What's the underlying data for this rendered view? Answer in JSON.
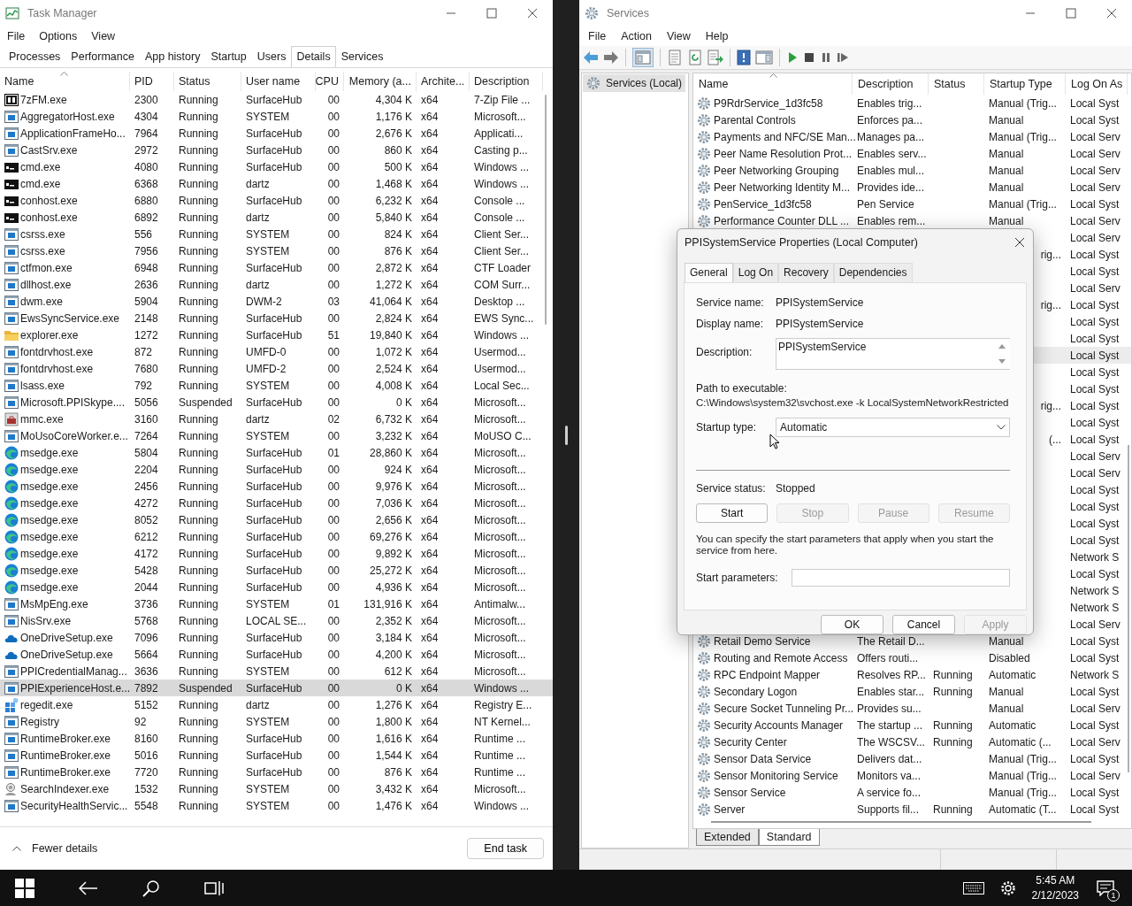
{
  "task_manager": {
    "window_title": "Task Manager",
    "menu": [
      "File",
      "Options",
      "View"
    ],
    "tabs": [
      {
        "label": "Processes",
        "selected": false
      },
      {
        "label": "Performance",
        "selected": false
      },
      {
        "label": "App history",
        "selected": false
      },
      {
        "label": "Startup",
        "selected": false
      },
      {
        "label": "Users",
        "selected": false
      },
      {
        "label": "Details",
        "selected": true
      },
      {
        "label": "Services",
        "selected": false
      }
    ],
    "columns": [
      "Name",
      "PID",
      "Status",
      "User name",
      "CPU",
      "Memory (a...",
      "Archite...",
      "Description"
    ],
    "rows": [
      {
        "kind": "zip",
        "name": "7zFM.exe",
        "pid": "2300",
        "status": "Running",
        "user": "SurfaceHub",
        "cpu": "00",
        "memory": "4,304 K",
        "arch": "x64",
        "description": "7-Zip File ...",
        "selected": false
      },
      {
        "kind": "app",
        "name": "AggregatorHost.exe",
        "pid": "4304",
        "status": "Running",
        "user": "SYSTEM",
        "cpu": "00",
        "memory": "1,176 K",
        "arch": "x64",
        "description": "Microsoft...",
        "selected": false
      },
      {
        "kind": "app",
        "name": "ApplicationFrameHo...",
        "pid": "7964",
        "status": "Running",
        "user": "SurfaceHub",
        "cpu": "00",
        "memory": "2,676 K",
        "arch": "x64",
        "description": "Applicati...",
        "selected": false
      },
      {
        "kind": "app",
        "name": "CastSrv.exe",
        "pid": "2972",
        "status": "Running",
        "user": "SurfaceHub",
        "cpu": "00",
        "memory": "860 K",
        "arch": "x64",
        "description": "Casting p...",
        "selected": false
      },
      {
        "kind": "console",
        "name": "cmd.exe",
        "pid": "4080",
        "status": "Running",
        "user": "SurfaceHub",
        "cpu": "00",
        "memory": "500 K",
        "arch": "x64",
        "description": "Windows ...",
        "selected": false
      },
      {
        "kind": "console",
        "name": "cmd.exe",
        "pid": "6368",
        "status": "Running",
        "user": "dartz",
        "cpu": "00",
        "memory": "1,468 K",
        "arch": "x64",
        "description": "Windows ...",
        "selected": false
      },
      {
        "kind": "console",
        "name": "conhost.exe",
        "pid": "6880",
        "status": "Running",
        "user": "SurfaceHub",
        "cpu": "00",
        "memory": "6,232 K",
        "arch": "x64",
        "description": "Console ...",
        "selected": false
      },
      {
        "kind": "console",
        "name": "conhost.exe",
        "pid": "6892",
        "status": "Running",
        "user": "dartz",
        "cpu": "00",
        "memory": "5,840 K",
        "arch": "x64",
        "description": "Console ...",
        "selected": false
      },
      {
        "kind": "app",
        "name": "csrss.exe",
        "pid": "556",
        "status": "Running",
        "user": "SYSTEM",
        "cpu": "00",
        "memory": "824 K",
        "arch": "x64",
        "description": "Client Ser...",
        "selected": false
      },
      {
        "kind": "app",
        "name": "csrss.exe",
        "pid": "7956",
        "status": "Running",
        "user": "SYSTEM",
        "cpu": "00",
        "memory": "876 K",
        "arch": "x64",
        "description": "Client Ser...",
        "selected": false
      },
      {
        "kind": "app",
        "name": "ctfmon.exe",
        "pid": "6948",
        "status": "Running",
        "user": "SurfaceHub",
        "cpu": "00",
        "memory": "2,872 K",
        "arch": "x64",
        "description": "CTF Loader",
        "selected": false
      },
      {
        "kind": "app",
        "name": "dllhost.exe",
        "pid": "2636",
        "status": "Running",
        "user": "dartz",
        "cpu": "00",
        "memory": "1,272 K",
        "arch": "x64",
        "description": "COM Surr...",
        "selected": false
      },
      {
        "kind": "app",
        "name": "dwm.exe",
        "pid": "5904",
        "status": "Running",
        "user": "DWM-2",
        "cpu": "03",
        "memory": "41,064 K",
        "arch": "x64",
        "description": "Desktop ...",
        "selected": false
      },
      {
        "kind": "app",
        "name": "EwsSyncService.exe",
        "pid": "2148",
        "status": "Running",
        "user": "SurfaceHub",
        "cpu": "00",
        "memory": "2,824 K",
        "arch": "x64",
        "description": "EWS Sync...",
        "selected": false
      },
      {
        "kind": "folder",
        "name": "explorer.exe",
        "pid": "1272",
        "status": "Running",
        "user": "SurfaceHub",
        "cpu": "51",
        "memory": "19,840 K",
        "arch": "x64",
        "description": "Windows ...",
        "selected": false
      },
      {
        "kind": "app",
        "name": "fontdrvhost.exe",
        "pid": "872",
        "status": "Running",
        "user": "UMFD-0",
        "cpu": "00",
        "memory": "1,072 K",
        "arch": "x64",
        "description": "Usermod...",
        "selected": false
      },
      {
        "kind": "app",
        "name": "fontdrvhost.exe",
        "pid": "7680",
        "status": "Running",
        "user": "UMFD-2",
        "cpu": "00",
        "memory": "2,524 K",
        "arch": "x64",
        "description": "Usermod...",
        "selected": false
      },
      {
        "kind": "app",
        "name": "lsass.exe",
        "pid": "792",
        "status": "Running",
        "user": "SYSTEM",
        "cpu": "00",
        "memory": "4,008 K",
        "arch": "x64",
        "description": "Local Sec...",
        "selected": false
      },
      {
        "kind": "app",
        "name": "Microsoft.PPISkype....",
        "pid": "5056",
        "status": "Suspended",
        "user": "SurfaceHub",
        "cpu": "00",
        "memory": "0 K",
        "arch": "x64",
        "description": "Microsoft...",
        "selected": false
      },
      {
        "kind": "toolbox",
        "name": "mmc.exe",
        "pid": "3160",
        "status": "Running",
        "user": "dartz",
        "cpu": "02",
        "memory": "6,732 K",
        "arch": "x64",
        "description": "Microsoft...",
        "selected": false
      },
      {
        "kind": "app",
        "name": "MoUsoCoreWorker.e...",
        "pid": "7264",
        "status": "Running",
        "user": "SYSTEM",
        "cpu": "00",
        "memory": "3,232 K",
        "arch": "x64",
        "description": "MoUSO C...",
        "selected": false
      },
      {
        "kind": "swirl",
        "name": "msedge.exe",
        "pid": "5804",
        "status": "Running",
        "user": "SurfaceHub",
        "cpu": "01",
        "memory": "28,860 K",
        "arch": "x64",
        "description": "Microsoft...",
        "selected": false
      },
      {
        "kind": "swirl",
        "name": "msedge.exe",
        "pid": "2204",
        "status": "Running",
        "user": "SurfaceHub",
        "cpu": "00",
        "memory": "924 K",
        "arch": "x64",
        "description": "Microsoft...",
        "selected": false
      },
      {
        "kind": "swirl",
        "name": "msedge.exe",
        "pid": "2456",
        "status": "Running",
        "user": "SurfaceHub",
        "cpu": "00",
        "memory": "9,976 K",
        "arch": "x64",
        "description": "Microsoft...",
        "selected": false
      },
      {
        "kind": "swirl",
        "name": "msedge.exe",
        "pid": "4272",
        "status": "Running",
        "user": "SurfaceHub",
        "cpu": "00",
        "memory": "7,036 K",
        "arch": "x64",
        "description": "Microsoft...",
        "selected": false
      },
      {
        "kind": "swirl",
        "name": "msedge.exe",
        "pid": "8052",
        "status": "Running",
        "user": "SurfaceHub",
        "cpu": "00",
        "memory": "2,656 K",
        "arch": "x64",
        "description": "Microsoft...",
        "selected": false
      },
      {
        "kind": "swirl",
        "name": "msedge.exe",
        "pid": "6212",
        "status": "Running",
        "user": "SurfaceHub",
        "cpu": "00",
        "memory": "69,276 K",
        "arch": "x64",
        "description": "Microsoft...",
        "selected": false
      },
      {
        "kind": "swirl",
        "name": "msedge.exe",
        "pid": "4172",
        "status": "Running",
        "user": "SurfaceHub",
        "cpu": "00",
        "memory": "9,892 K",
        "arch": "x64",
        "description": "Microsoft...",
        "selected": false
      },
      {
        "kind": "swirl",
        "name": "msedge.exe",
        "pid": "5428",
        "status": "Running",
        "user": "SurfaceHub",
        "cpu": "00",
        "memory": "25,272 K",
        "arch": "x64",
        "description": "Microsoft...",
        "selected": false
      },
      {
        "kind": "swirl",
        "name": "msedge.exe",
        "pid": "2044",
        "status": "Running",
        "user": "SurfaceHub",
        "cpu": "00",
        "memory": "4,936 K",
        "arch": "x64",
        "description": "Microsoft...",
        "selected": false
      },
      {
        "kind": "app",
        "name": "MsMpEng.exe",
        "pid": "3736",
        "status": "Running",
        "user": "SYSTEM",
        "cpu": "01",
        "memory": "131,916 K",
        "arch": "x64",
        "description": "Antimalw...",
        "selected": false
      },
      {
        "kind": "app",
        "name": "NisSrv.exe",
        "pid": "5768",
        "status": "Running",
        "user": "LOCAL SE...",
        "cpu": "00",
        "memory": "2,352 K",
        "arch": "x64",
        "description": "Microsoft...",
        "selected": false
      },
      {
        "kind": "cloud",
        "name": "OneDriveSetup.exe",
        "pid": "7096",
        "status": "Running",
        "user": "SurfaceHub",
        "cpu": "00",
        "memory": "3,184 K",
        "arch": "x64",
        "description": "Microsoft...",
        "selected": false
      },
      {
        "kind": "cloud",
        "name": "OneDriveSetup.exe",
        "pid": "5664",
        "status": "Running",
        "user": "SurfaceHub",
        "cpu": "00",
        "memory": "4,200 K",
        "arch": "x64",
        "description": "Microsoft...",
        "selected": false
      },
      {
        "kind": "app",
        "name": "PPICredentialManag...",
        "pid": "3636",
        "status": "Running",
        "user": "SYSTEM",
        "cpu": "00",
        "memory": "612 K",
        "arch": "x64",
        "description": "Microsoft...",
        "selected": false
      },
      {
        "kind": "app",
        "name": "PPIExperienceHost.e...",
        "pid": "7892",
        "status": "Suspended",
        "user": "SurfaceHub",
        "cpu": "00",
        "memory": "0 K",
        "arch": "x64",
        "description": "Windows ...",
        "selected": true
      },
      {
        "kind": "cubes",
        "name": "regedit.exe",
        "pid": "5152",
        "status": "Running",
        "user": "dartz",
        "cpu": "00",
        "memory": "1,276 K",
        "arch": "x64",
        "description": "Registry E...",
        "selected": false
      },
      {
        "kind": "app",
        "name": "Registry",
        "pid": "92",
        "status": "Running",
        "user": "SYSTEM",
        "cpu": "00",
        "memory": "1,800 K",
        "arch": "x64",
        "description": "NT Kernel...",
        "selected": false
      },
      {
        "kind": "app",
        "name": "RuntimeBroker.exe",
        "pid": "8160",
        "status": "Running",
        "user": "SurfaceHub",
        "cpu": "00",
        "memory": "1,616 K",
        "arch": "x64",
        "description": "Runtime ...",
        "selected": false
      },
      {
        "kind": "app",
        "name": "RuntimeBroker.exe",
        "pid": "5016",
        "status": "Running",
        "user": "SurfaceHub",
        "cpu": "00",
        "memory": "1,544 K",
        "arch": "x64",
        "description": "Runtime ...",
        "selected": false
      },
      {
        "kind": "app",
        "name": "RuntimeBroker.exe",
        "pid": "7720",
        "status": "Running",
        "user": "SurfaceHub",
        "cpu": "00",
        "memory": "876 K",
        "arch": "x64",
        "description": "Runtime ...",
        "selected": false
      },
      {
        "kind": "magnifier",
        "name": "SearchIndexer.exe",
        "pid": "1532",
        "status": "Running",
        "user": "SYSTEM",
        "cpu": "00",
        "memory": "3,432 K",
        "arch": "x64",
        "description": "Microsoft...",
        "selected": false
      },
      {
        "kind": "app",
        "name": "SecurityHealthServic...",
        "pid": "5548",
        "status": "Running",
        "user": "SYSTEM",
        "cpu": "00",
        "memory": "1,476 K",
        "arch": "x64",
        "description": "Windows ...",
        "selected": false
      }
    ],
    "footer": {
      "toggle": "Fewer details",
      "end_task": "End task"
    }
  },
  "services": {
    "window_title": "Services",
    "menu": [
      "File",
      "Action",
      "View",
      "Help"
    ],
    "tree": [
      {
        "label": "Services (Local)",
        "selected": true
      }
    ],
    "columns": [
      "Name",
      "Description",
      "Status",
      "Startup Type",
      "Log On As"
    ],
    "rows": [
      {
        "kind": "full",
        "name": "P9RdrService_1d3fc58",
        "description": "Enables trig...",
        "startup_type": "Manual (Trig...",
        "log_on": "Local Syst",
        "selected": false
      },
      {
        "kind": "full",
        "name": "Parental Controls",
        "description": "Enforces pa...",
        "startup_type": "Manual",
        "log_on": "Local Syst",
        "selected": false
      },
      {
        "kind": "full",
        "name": "Payments and NFC/SE Man...",
        "description": "Manages pa...",
        "startup_type": "Manual (Trig...",
        "log_on": "Local Serv",
        "selected": false
      },
      {
        "kind": "full",
        "name": "Peer Name Resolution Prot...",
        "description": "Enables serv...",
        "startup_type": "Manual",
        "log_on": "Local Serv",
        "selected": false
      },
      {
        "kind": "full",
        "name": "Peer Networking Grouping",
        "description": "Enables mul...",
        "startup_type": "Manual",
        "log_on": "Local Serv",
        "selected": false
      },
      {
        "kind": "full",
        "name": "Peer Networking Identity M...",
        "description": "Provides ide...",
        "startup_type": "Manual",
        "log_on": "Local Serv",
        "selected": false
      },
      {
        "kind": "full",
        "name": "PenService_1d3fc58",
        "description": "Pen Service",
        "startup_type": "Manual (Trig...",
        "log_on": "Local Syst",
        "selected": false
      },
      {
        "kind": "full",
        "name": "Performance Counter DLL ...",
        "description": "Enables rem...",
        "startup_type": "Manual",
        "log_on": "Local Serv",
        "selected": false
      },
      {
        "kind": "covered",
        "log_on": "Local Serv",
        "selected": false
      },
      {
        "kind": "covered",
        "startup_type": "rig...",
        "log_on": "Local Syst",
        "selected": false
      },
      {
        "kind": "covered",
        "log_on": "Local Syst",
        "selected": false
      },
      {
        "kind": "covered",
        "log_on": "Local Serv",
        "selected": false
      },
      {
        "kind": "covered",
        "startup_type": "rig...",
        "log_on": "Local Syst",
        "selected": false
      },
      {
        "kind": "covered",
        "log_on": "Local Syst",
        "selected": false
      },
      {
        "kind": "covered",
        "log_on": "Local Syst",
        "selected": false
      },
      {
        "kind": "covered",
        "log_on": "Local Syst",
        "selected": true
      },
      {
        "kind": "covered",
        "log_on": "Local Syst",
        "selected": false
      },
      {
        "kind": "covered",
        "log_on": "Local Syst",
        "selected": false
      },
      {
        "kind": "covered",
        "startup_type": "rig...",
        "log_on": "Local Syst",
        "selected": false
      },
      {
        "kind": "covered",
        "log_on": "Local Syst",
        "selected": false
      },
      {
        "kind": "covered",
        "startup_type": "(...",
        "log_on": "Local Syst",
        "selected": false
      },
      {
        "kind": "covered",
        "log_on": "Local Serv",
        "selected": false
      },
      {
        "kind": "covered",
        "log_on": "Local Serv",
        "selected": false
      },
      {
        "kind": "covered",
        "log_on": "Local Syst",
        "selected": false
      },
      {
        "kind": "covered",
        "log_on": "Local Syst",
        "selected": false
      },
      {
        "kind": "covered",
        "log_on": "Local Syst",
        "selected": false
      },
      {
        "kind": "covered",
        "log_on": "Local Syst",
        "selected": false
      },
      {
        "kind": "covered",
        "log_on": "Network S",
        "selected": false
      },
      {
        "kind": "covered",
        "log_on": "Local Syst",
        "selected": false
      },
      {
        "kind": "covered",
        "log_on": "Network S",
        "selected": false
      },
      {
        "kind": "covered",
        "log_on": "Network S",
        "selected": false
      },
      {
        "kind": "covered",
        "log_on": "Local Serv",
        "selected": false
      },
      {
        "kind": "full",
        "name": "Retail Demo Service",
        "description": "The Retail D...",
        "startup_type": "Manual",
        "log_on": "Local Syst",
        "selected": false
      },
      {
        "kind": "full",
        "name": "Routing and Remote Access",
        "description": "Offers routi...",
        "startup_type": "Disabled",
        "log_on": "Local Syst",
        "selected": false
      },
      {
        "kind": "full",
        "name": "RPC Endpoint Mapper",
        "description": "Resolves RP...",
        "status": "Running",
        "startup_type": "Automatic",
        "log_on": "Network S",
        "selected": false
      },
      {
        "kind": "full",
        "name": "Secondary Logon",
        "description": "Enables star...",
        "status": "Running",
        "startup_type": "Manual",
        "log_on": "Local Syst",
        "selected": false
      },
      {
        "kind": "full",
        "name": "Secure Socket Tunneling Pr...",
        "description": "Provides su...",
        "startup_type": "Manual",
        "log_on": "Local Serv",
        "selected": false
      },
      {
        "kind": "full",
        "name": "Security Accounts Manager",
        "description": "The startup ...",
        "status": "Running",
        "startup_type": "Automatic",
        "log_on": "Local Syst",
        "selected": false
      },
      {
        "kind": "full",
        "name": "Security Center",
        "description": "The WSCSV...",
        "status": "Running",
        "startup_type": "Automatic (...",
        "log_on": "Local Serv",
        "selected": false
      },
      {
        "kind": "full",
        "name": "Sensor Data Service",
        "description": "Delivers dat...",
        "startup_type": "Manual (Trig...",
        "log_on": "Local Syst",
        "selected": false
      },
      {
        "kind": "full",
        "name": "Sensor Monitoring Service",
        "description": "Monitors va...",
        "startup_type": "Manual (Trig...",
        "log_on": "Local Serv",
        "selected": false
      },
      {
        "kind": "full",
        "name": "Sensor Service",
        "description": "A service fo...",
        "startup_type": "Manual (Trig...",
        "log_on": "Local Syst",
        "selected": false
      },
      {
        "kind": "full",
        "name": "Server",
        "description": "Supports fil...",
        "status": "Running",
        "startup_type": "Automatic (T...",
        "log_on": "Local Syst",
        "selected": false
      }
    ],
    "view_tabs": [
      {
        "label": "Extended",
        "selected": false
      },
      {
        "label": "Standard",
        "selected": true
      }
    ]
  },
  "dialog": {
    "title": "PPISystemService Properties (Local Computer)",
    "tabs": [
      {
        "label": "General",
        "selected": true
      },
      {
        "label": "Log On",
        "selected": false
      },
      {
        "label": "Recovery",
        "selected": false
      },
      {
        "label": "Dependencies",
        "selected": false
      }
    ],
    "service_name": {
      "label": "Service name:",
      "value": "PPISystemService"
    },
    "display_name": {
      "label": "Display name:",
      "value": "PPISystemService"
    },
    "description": {
      "label": "Description:",
      "value": "PPISystemService"
    },
    "path": {
      "label": "Path to executable:",
      "value": "C:\\Windows\\system32\\svchost.exe -k LocalSystemNetworkRestricted"
    },
    "startup_type": {
      "label": "Startup type:",
      "value": "Automatic"
    },
    "service_status": {
      "label": "Service status:",
      "value": "Stopped"
    },
    "control_buttons": [
      {
        "label": "Start",
        "disabled": false
      },
      {
        "label": "Stop",
        "disabled": true
      },
      {
        "label": "Pause",
        "disabled": true
      },
      {
        "label": "Resume",
        "disabled": true
      }
    ],
    "note": "You can specify the start parameters that apply when you start the service from here.",
    "start_parameters": {
      "label": "Start parameters:"
    },
    "buttons": [
      {
        "label": "OK",
        "disabled": false
      },
      {
        "label": "Cancel",
        "disabled": false
      },
      {
        "label": "Apply",
        "disabled": true
      }
    ]
  },
  "taskbar": {
    "time": "5:45 AM",
    "date": "2/12/2023",
    "notification_count": "1"
  }
}
